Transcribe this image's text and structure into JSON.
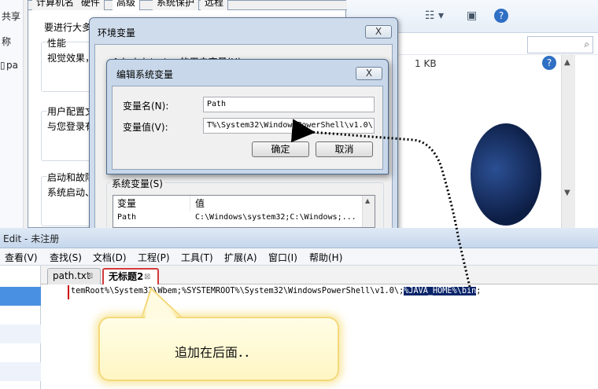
{
  "explorer": {
    "left_labels": [
      "共享",
      "称",
      "pa"
    ],
    "file_size": "1 KB"
  },
  "sysprops": {
    "tabs": [
      "计算机名",
      "硬件",
      "高级",
      "系统保护",
      "远程"
    ],
    "intro": "要进行大多",
    "perf_title": "性能",
    "perf_desc": "视觉效果，",
    "profile_title": "用户配置文",
    "profile_desc": "与您登录有",
    "startup_title": "启动和故障",
    "startup_desc": "系统启动、"
  },
  "env_dialog": {
    "title": "环境变量",
    "close_label": "X",
    "user_vars_label": "Administrator 的用户变量(U)",
    "system_vars_label": "系统变量(S)",
    "columns": [
      "变量",
      "值"
    ],
    "rows": [
      {
        "name": "Path",
        "value": "C:\\Windows\\system32;C:\\Windows;..."
      }
    ]
  },
  "edit_dialog": {
    "title": "编辑系统变量",
    "close_label": "X",
    "name_label": "变量名(N):",
    "value_label": "变量值(V):",
    "name_value": "Path",
    "value_value": "T%\\System32\\WindowsPowerShell\\v1.0\\",
    "ok_label": "确定",
    "cancel_label": "取消"
  },
  "editor": {
    "title": "Edit - 未注册",
    "menu": [
      "查看(V)",
      "查找(S)",
      "文档(D)",
      "工程(P)",
      "工具(T)",
      "扩展(A)",
      "窗口(I)",
      "帮助(H)"
    ],
    "tabs": [
      {
        "label": "path.txt",
        "active": false
      },
      {
        "label": "无标题2",
        "active": true
      }
    ],
    "line_before": "temRoot%\\System32\\Wbem;%SYSTEMROOT%\\System32\\WindowsPowerShell\\v1.0\\;",
    "line_selected": "%JAVA_HOME%\\bin",
    "line_after": ";"
  },
  "callout": {
    "text": "追加在后面．．"
  },
  "colors": {
    "selection_bg": "#0a246a",
    "active_tab_border": "#d33b3b",
    "callout_fill": "#fff8d0"
  }
}
